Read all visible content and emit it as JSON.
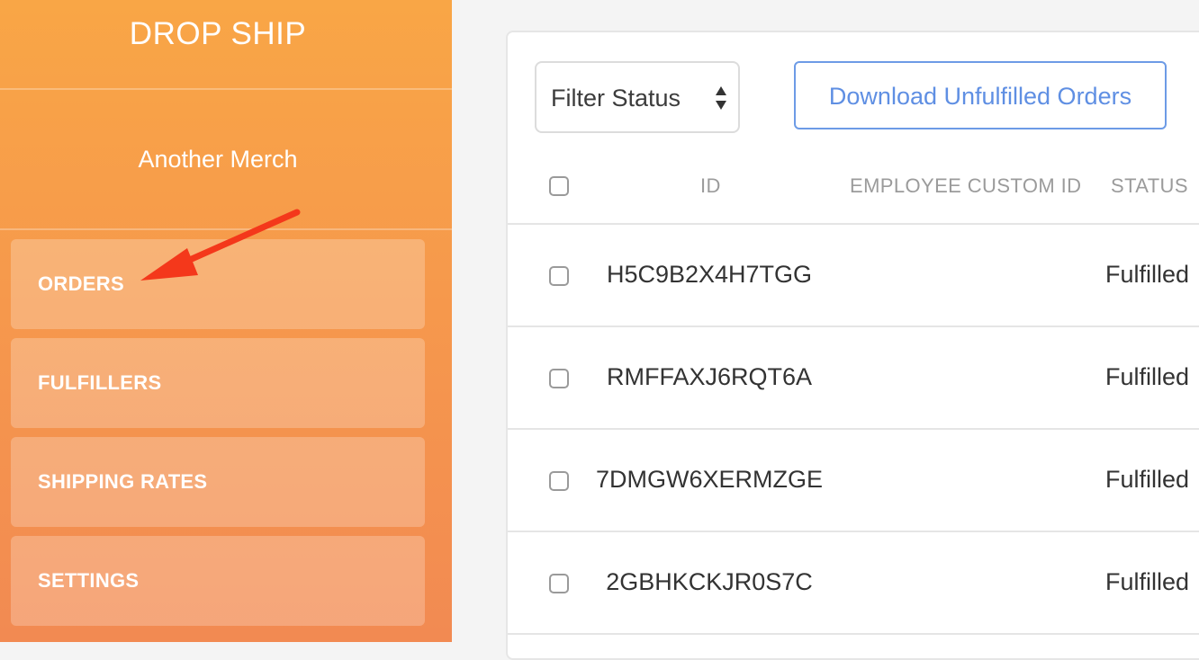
{
  "sidebar": {
    "brand": "DROP SHIP",
    "merchant": "Another Merch",
    "nav": [
      {
        "label": "ORDERS"
      },
      {
        "label": "FULFILLERS"
      },
      {
        "label": "SHIPPING RATES"
      },
      {
        "label": "SETTINGS"
      }
    ]
  },
  "toolbar": {
    "filter_label": "Filter Status",
    "download_label": "Download Unfulfilled Orders"
  },
  "table": {
    "headers": {
      "id": "ID",
      "employee_custom_id": "EMPLOYEE CUSTOM ID",
      "status": "STATUS"
    },
    "rows": [
      {
        "id": "H5C9B2X4H7TGG",
        "employee_custom_id": "",
        "status": "Fulfilled"
      },
      {
        "id": "RMFFAXJ6RQT6A",
        "employee_custom_id": "",
        "status": "Fulfilled"
      },
      {
        "id": "7DMGW6XERMZGE",
        "employee_custom_id": "",
        "status": "Fulfilled"
      },
      {
        "id": "2GBHKCKJR0S7C",
        "employee_custom_id": "",
        "status": "Fulfilled"
      }
    ]
  },
  "colors": {
    "sidebar_top": "#f9a646",
    "sidebar_bottom": "#f28a52",
    "accent_blue": "#5f8fe3",
    "arrow_red": "#f4381b"
  },
  "annotation": {
    "icon": "arrow-icon"
  }
}
